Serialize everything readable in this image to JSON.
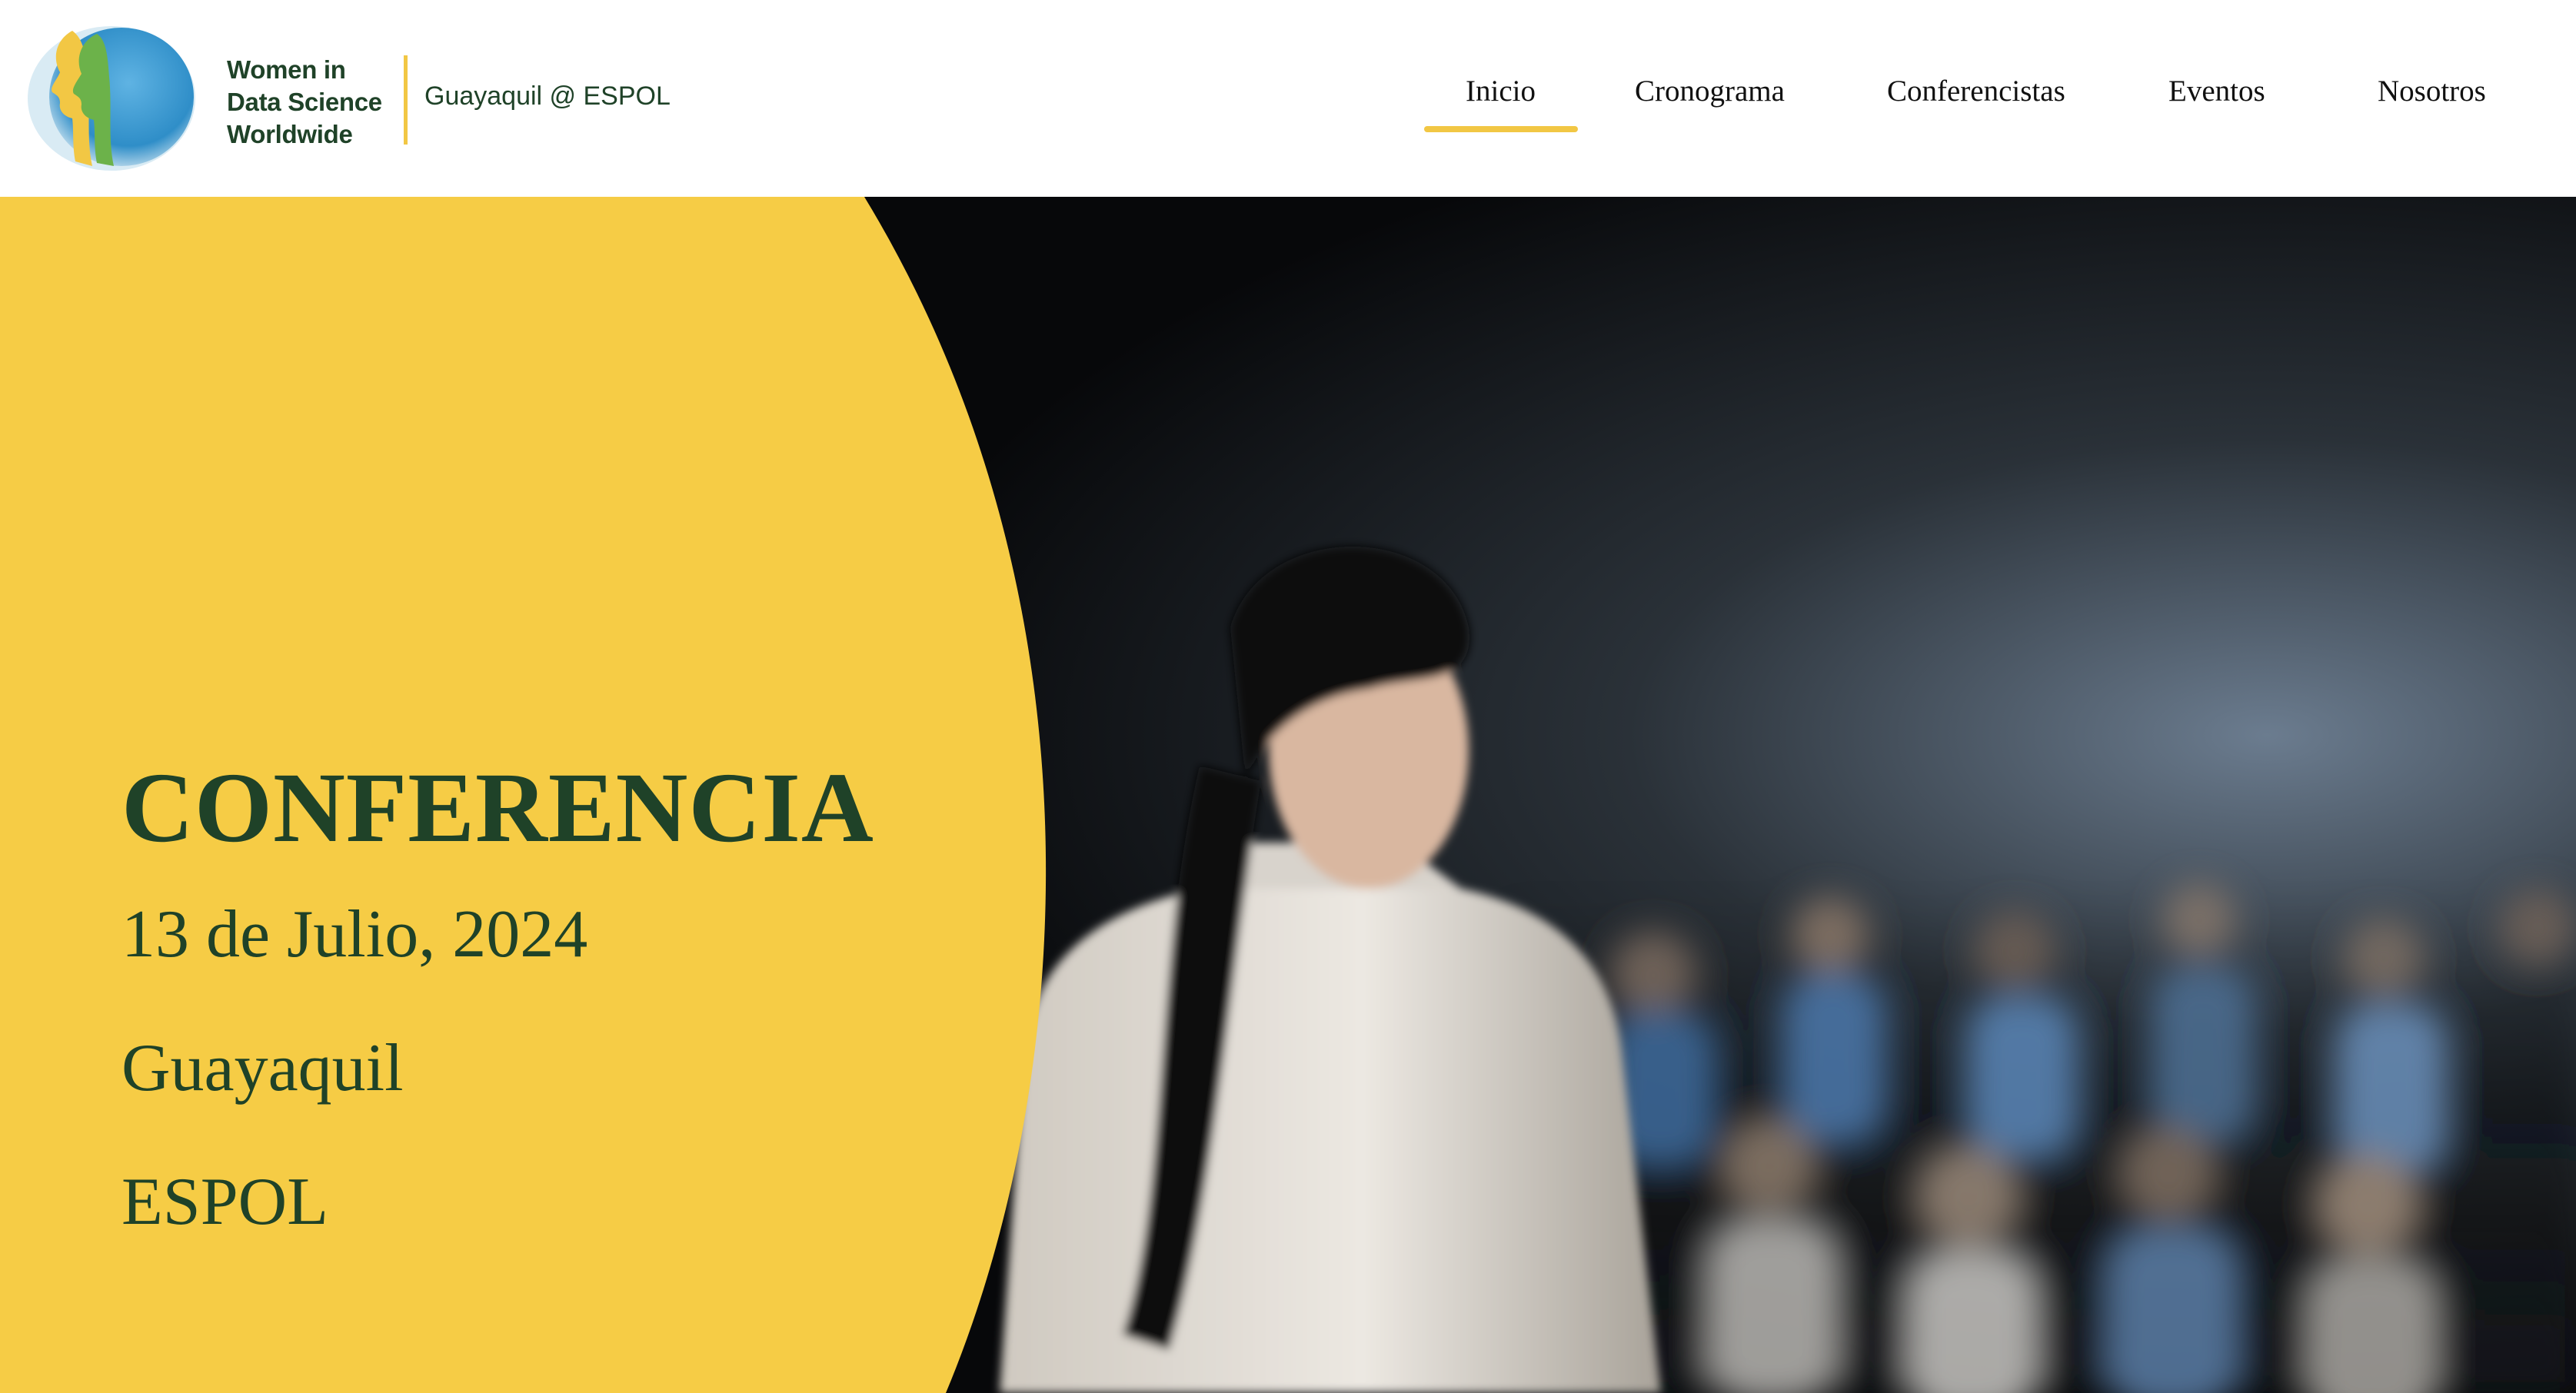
{
  "brand": {
    "name_lines": [
      "Women in",
      "Data Science",
      "Worldwide"
    ],
    "subtitle": "Guayaquil @ ESPOL",
    "colors": {
      "green": "#1f4228",
      "yellow": "#f2c744",
      "blue": "#3f9bd1"
    }
  },
  "nav": {
    "items": [
      {
        "label": "Inicio",
        "active": true
      },
      {
        "label": "Cronograma",
        "active": false
      },
      {
        "label": "Conferencistas",
        "active": false
      },
      {
        "label": "Eventos",
        "active": false
      },
      {
        "label": "Nosotros",
        "active": false
      }
    ]
  },
  "hero": {
    "title": "CONFERENCIA",
    "date": "13 de Julio, 2024",
    "city": "Guayaquil",
    "venue": "ESPOL",
    "panel_color": "#f6cc45"
  }
}
